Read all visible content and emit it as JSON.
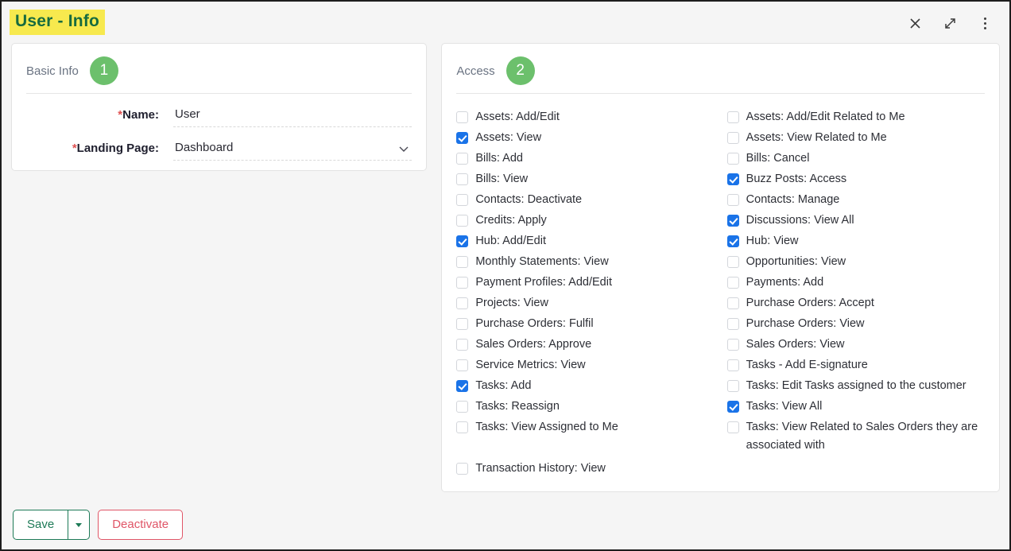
{
  "window": {
    "title": "User - Info",
    "actions": [
      {
        "name": "close-icon",
        "label": "Close"
      },
      {
        "name": "expand-icon",
        "label": "Expand"
      },
      {
        "name": "more-options-icon",
        "label": "More options"
      }
    ]
  },
  "colors": {
    "title_highlight": "#f7e94e",
    "title_text": "#176b3f",
    "badge_green": "#6cc06c",
    "checkbox_checked": "#1a73e8",
    "save_green": "#1d7a57",
    "deactivate_red": "#e05567",
    "required_red": "#e05252"
  },
  "basic_info": {
    "title": "Basic Info",
    "badge": "1",
    "fields": [
      {
        "label": "Name:",
        "required": "*",
        "value": "User",
        "type": "text"
      },
      {
        "label": "Landing Page:",
        "required": "*",
        "value": "Dashboard",
        "type": "select"
      }
    ]
  },
  "access": {
    "title": "Access",
    "badge": "2",
    "left_column": [
      {
        "label": "Assets: Add/Edit",
        "checked": false
      },
      {
        "label": "Assets: View",
        "checked": true
      },
      {
        "label": "Bills: Add",
        "checked": false
      },
      {
        "label": "Bills: View",
        "checked": false
      },
      {
        "label": "Contacts: Deactivate",
        "checked": false
      },
      {
        "label": "Credits: Apply",
        "checked": false
      },
      {
        "label": "Hub: Add/Edit",
        "checked": true
      },
      {
        "label": "Monthly Statements: View",
        "checked": false
      },
      {
        "label": "Payment Profiles: Add/Edit",
        "checked": false
      },
      {
        "label": "Projects: View",
        "checked": false
      },
      {
        "label": "Purchase Orders: Fulfil",
        "checked": false
      },
      {
        "label": "Sales Orders: Approve",
        "checked": false
      },
      {
        "label": "Service Metrics: View",
        "checked": false
      },
      {
        "label": "Tasks: Add",
        "checked": true
      },
      {
        "label": "Tasks: Reassign",
        "checked": false
      },
      {
        "label": "Tasks: View Assigned to Me",
        "checked": false
      },
      {
        "label": "Transaction History: View",
        "checked": false,
        "gap_before": true
      }
    ],
    "right_column": [
      {
        "label": "Assets: Add/Edit Related to Me",
        "checked": false
      },
      {
        "label": "Assets: View Related to Me",
        "checked": false
      },
      {
        "label": "Bills: Cancel",
        "checked": false
      },
      {
        "label": "Buzz Posts: Access",
        "checked": true
      },
      {
        "label": "Contacts: Manage",
        "checked": false
      },
      {
        "label": "Discussions: View All",
        "checked": true
      },
      {
        "label": "Hub: View",
        "checked": true
      },
      {
        "label": "Opportunities: View",
        "checked": false
      },
      {
        "label": "Payments: Add",
        "checked": false
      },
      {
        "label": "Purchase Orders: Accept",
        "checked": false
      },
      {
        "label": "Purchase Orders: View",
        "checked": false
      },
      {
        "label": "Sales Orders: View",
        "checked": false
      },
      {
        "label": "Tasks - Add E-signature",
        "checked": false
      },
      {
        "label": "Tasks: Edit Tasks assigned to the customer",
        "checked": false
      },
      {
        "label": "Tasks: View All",
        "checked": true
      },
      {
        "label": "Tasks: View Related to Sales Orders they are associated with",
        "checked": false
      }
    ]
  },
  "footer": {
    "save_label": "Save",
    "save_dropdown_icon": "caret-down-icon",
    "deactivate_label": "Deactivate"
  }
}
